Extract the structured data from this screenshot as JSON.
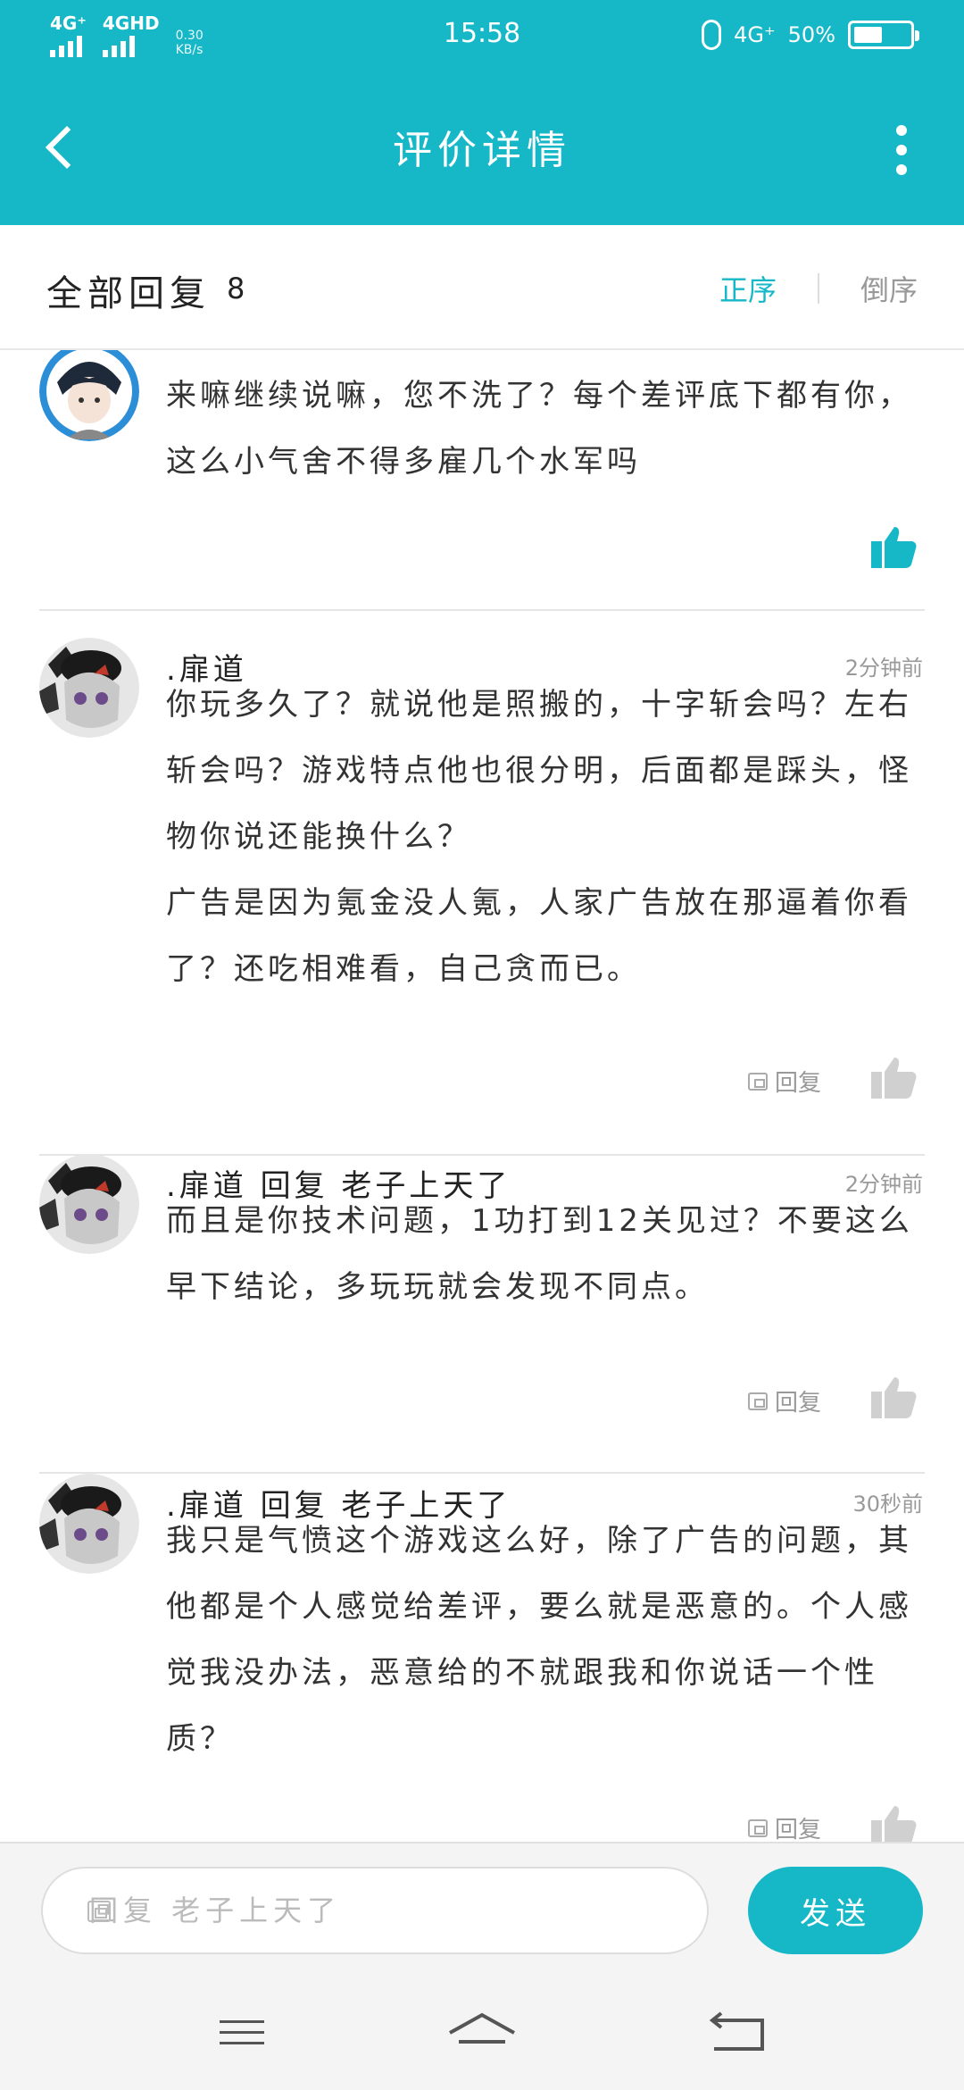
{
  "status_bar": {
    "signal1": "4G⁺",
    "signal2": "4GHD",
    "speed_value": "0.30",
    "speed_unit": "KB/s",
    "time": "15:58",
    "network": "4G⁺",
    "battery_text": "50%",
    "battery_level": 0.5
  },
  "app_bar": {
    "title": "评价详情"
  },
  "filter": {
    "label": "全部回复",
    "count": "8",
    "sort_asc": "正序",
    "sort_desc": "倒序"
  },
  "comments": [
    {
      "user": "",
      "time": "",
      "text": "来嘛继续说嘛，您不洗了？每个差评底下都有你，这么小气舍不得多雇几个水军吗",
      "reply_label": "",
      "liked": true
    },
    {
      "user": ".扉道",
      "time": "2分钟前",
      "text": "你玩多久了？就说他是照搬的，十字斩会吗？左右斩会吗？游戏特点他也很分明，后面都是踩头，怪物你说还能换什么？\n广告是因为氪金没人氪，人家广告放在那逼着你看了？还吃相难看，自己贪而已。",
      "reply_label": "回复",
      "liked": false
    },
    {
      "user": ".扉道  回复  老子上天了",
      "time": "2分钟前",
      "text": "而且是你技术问题，1功打到12关见过？不要这么早下结论，多玩玩就会发现不同点。",
      "reply_label": "回复",
      "liked": false
    },
    {
      "user": ".扉道  回复  老子上天了",
      "time": "30秒前",
      "text": "我只是气愤这个游戏这么好，除了广告的问题，其他都是个人感觉给差评，要么就是恶意的。个人感觉我没办法，恶意给的不就跟我和你说话一个性质？",
      "reply_label": "回复",
      "liked": false
    }
  ],
  "composer": {
    "placeholder": "回复 老子上天了",
    "send_label": "发送"
  },
  "colors": {
    "accent": "#16b8c8",
    "like_gray": "#d0d0d0"
  }
}
